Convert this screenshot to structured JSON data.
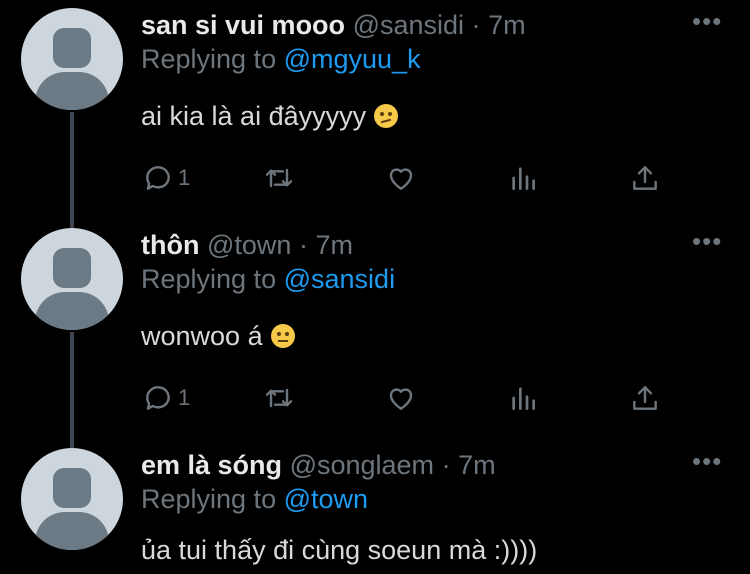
{
  "tweets": [
    {
      "display_name": "san si vui mooo",
      "handle": "@sansidi",
      "time": "7m",
      "replying_prefix": "Replying to",
      "replying_to": "@mgyuu_k",
      "text": "ai kia là ai đâyyyyy",
      "emoji": "thinking-face",
      "reply_count": "1"
    },
    {
      "display_name": "thôn",
      "handle": "@town",
      "time": "7m",
      "replying_prefix": "Replying to",
      "replying_to": "@sansidi",
      "text": "wonwoo á",
      "emoji": "neutral-face",
      "reply_count": "1"
    },
    {
      "display_name": "em là sóng",
      "handle": "@songlaem",
      "time": "7m",
      "replying_prefix": "Replying to",
      "replying_to": "@town",
      "text": "ủa tui thấy đi cùng soeun mà :))))"
    }
  ],
  "separator": "·",
  "more_label": "•••",
  "colors": {
    "background": "#000000",
    "link": "#1d9bf0",
    "muted": "#6e767d",
    "thread_line": "#3d4550"
  }
}
